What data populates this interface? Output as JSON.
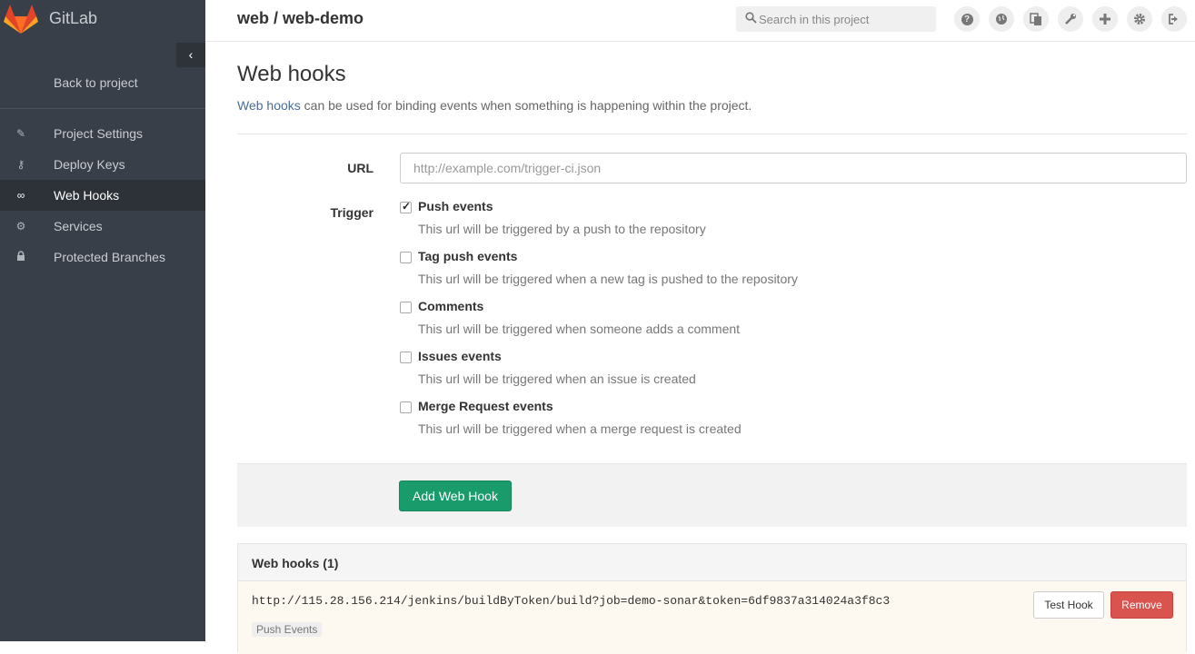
{
  "app": {
    "brand": "GitLab"
  },
  "header": {
    "project_path": "web / web-demo",
    "search_placeholder": "Search in this project",
    "icons": [
      "help-icon",
      "explore-icon",
      "snippets-icon",
      "admin-icon",
      "new-project-icon",
      "settings-icon",
      "sign-out-icon"
    ]
  },
  "sidebar": {
    "back_label": "Back to project",
    "items": [
      {
        "label": "Project Settings",
        "icon": "edit-icon",
        "active": false
      },
      {
        "label": "Deploy Keys",
        "icon": "key-icon",
        "active": false
      },
      {
        "label": "Web Hooks",
        "icon": "link-icon",
        "active": true
      },
      {
        "label": "Services",
        "icon": "cogs-icon",
        "active": false
      },
      {
        "label": "Protected Branches",
        "icon": "lock-icon",
        "active": false
      }
    ]
  },
  "main": {
    "title": "Web hooks",
    "intro_link": "Web hooks",
    "intro_text": " can be used for binding events when something is happening within the project.",
    "url_label": "URL",
    "url_placeholder": "http://example.com/trigger-ci.json",
    "trigger_label": "Trigger",
    "triggers": [
      {
        "title": "Push events",
        "desc": "This url will be triggered by a push to the repository",
        "checked": true
      },
      {
        "title": "Tag push events",
        "desc": "This url will be triggered when a new tag is pushed to the repository",
        "checked": false
      },
      {
        "title": "Comments",
        "desc": "This url will be triggered when someone adds a comment",
        "checked": false
      },
      {
        "title": "Issues events",
        "desc": "This url will be triggered when an issue is created",
        "checked": false
      },
      {
        "title": "Merge Request events",
        "desc": "This url will be triggered when a merge request is created",
        "checked": false
      }
    ],
    "add_button": "Add Web Hook",
    "hooks_panel": {
      "title": "Web hooks (1)",
      "hooks": [
        {
          "url": "http://115.28.156.214/jenkins/buildByToken/build?job=demo-sonar&token=6df9837a314024a3f8c3",
          "badge": "Push Events",
          "test_label": "Test Hook",
          "remove_label": "Remove"
        }
      ]
    }
  },
  "colors": {
    "sidebar": "#393f48",
    "accent_green": "#1a9b6c",
    "danger": "#d9534f",
    "link": "#4a6c9b"
  }
}
